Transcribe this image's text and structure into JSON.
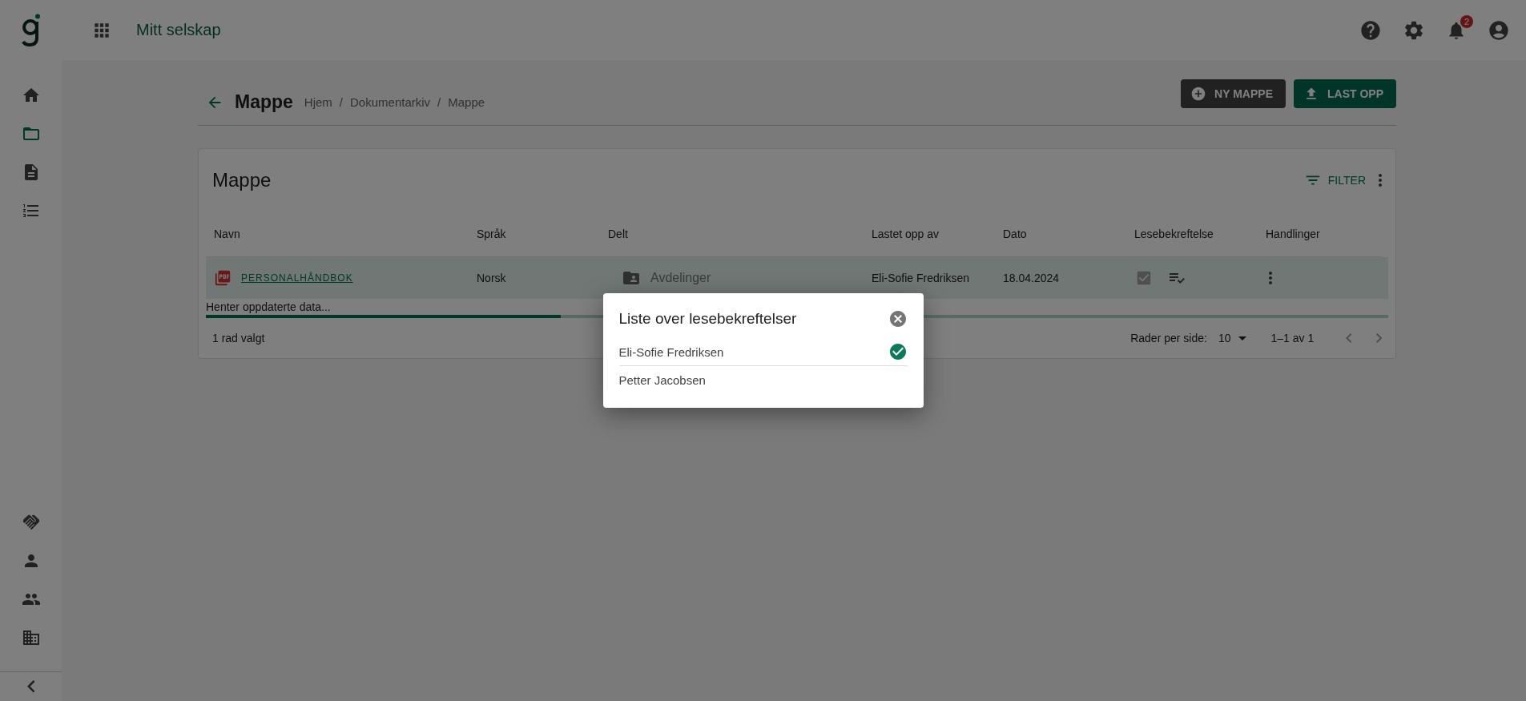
{
  "app": {
    "title": "Mitt selskap",
    "notifications": "2"
  },
  "sidebar": {
    "top": [
      {
        "kind": "home",
        "selected": false
      },
      {
        "kind": "folder",
        "selected": true
      },
      {
        "kind": "document",
        "selected": false
      },
      {
        "kind": "numbered-list",
        "selected": false
      }
    ],
    "bottom": [
      {
        "kind": "handshake",
        "selected": false
      },
      {
        "kind": "person",
        "selected": false
      },
      {
        "kind": "people",
        "selected": false
      },
      {
        "kind": "building",
        "selected": false
      }
    ]
  },
  "page": {
    "title": "Mappe",
    "breadcrumbs": [
      {
        "text": "Hjem"
      },
      {
        "separator": "/",
        "text": "Dokumentarkiv"
      },
      {
        "separator": "/",
        "text": "Mappe"
      }
    ],
    "buttons": [
      {
        "label": "NY MAPPE",
        "kind": "secondary"
      },
      {
        "label": "LAST OPP",
        "kind": "primary"
      }
    ]
  },
  "card": {
    "title": "Mappe",
    "filter": "FILTER"
  },
  "table": {
    "columns": [
      "Navn",
      "Språk",
      "Delt",
      "Lastet opp av",
      "Dato",
      "Lesebekreftelse",
      "Handlinger"
    ],
    "rows": [
      {
        "selected": true,
        "name": "PERSONALHÅNDBOK",
        "language": "Norsk",
        "shared": "Avdelinger",
        "uploaded_by": "Eli-Sofie Fredriksen",
        "date": "18.04.2024",
        "read_checked": true
      }
    ]
  },
  "loading": {
    "text": "Henter oppdaterte data...",
    "level": 0.3
  },
  "footer": {
    "selection": "1 rad valgt",
    "rows_per_page_label": "Rader per side:",
    "rows_per_page": "10",
    "range": "1–1 av 1"
  },
  "dialog": {
    "title": "Liste over lesebekreftelser",
    "items": [
      {
        "name": "Eli-Sofie Fredriksen",
        "confirmed": true
      },
      {
        "name": "Petter Jacobsen",
        "confirmed": false
      }
    ]
  }
}
